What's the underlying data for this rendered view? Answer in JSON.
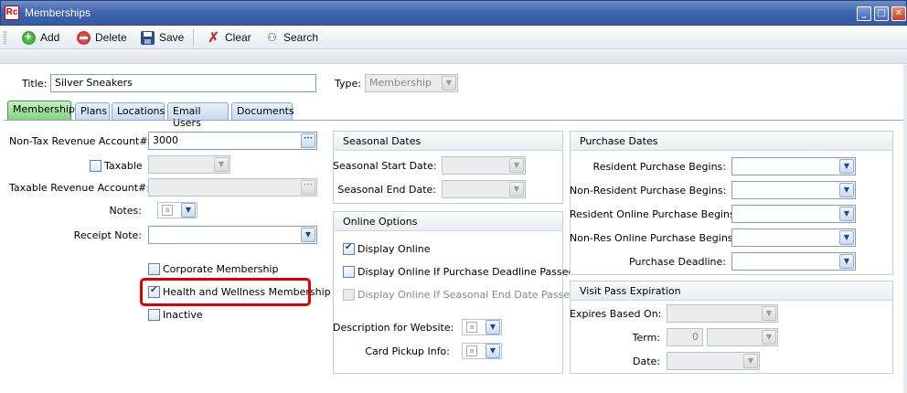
{
  "window": {
    "title": "Memberships",
    "app_icon": "Rc"
  },
  "toolbar": {
    "add": "Add",
    "delete": "Delete",
    "save": "Save",
    "clear": "Clear",
    "search": "Search"
  },
  "header": {
    "title_label": "Title:",
    "title_value": "Silver Sneakers",
    "type_label": "Type:",
    "type_value": "Membership"
  },
  "tabs": [
    "Membership",
    "Plans",
    "Locations",
    "Email Users",
    "Documents"
  ],
  "left": {
    "ntra_label": "Non-Tax Revenue Account#:",
    "ntra_value": "3000",
    "taxable_label": "Taxable",
    "tra_label": "Taxable Revenue Account#:",
    "notes_label": "Notes:",
    "receipt_label": "Receipt Note:",
    "corporate_label": "Corporate Membership",
    "health_label": "Health and Wellness Membership",
    "inactive_label": "Inactive"
  },
  "seasonal": {
    "title": "Seasonal Dates",
    "start_label": "Seasonal Start Date:",
    "end_label": "Seasonal End Date:"
  },
  "online": {
    "title": "Online Options",
    "display_online": "Display Online",
    "display_deadline": "Display Online If Purchase Deadline Passed",
    "display_seasonal": "Display Online If Seasonal End Date Passed",
    "desc_label": "Description for Website:",
    "card_label": "Card Pickup Info:"
  },
  "purchase": {
    "title": "Purchase Dates",
    "rows": [
      "Resident Purchase Begins:",
      "Non-Resident Purchase Begins:",
      "Resident Online Purchase Begins:",
      "Non-Res Online Purchase Begins:",
      "Purchase Deadline:"
    ]
  },
  "visit": {
    "title": "Visit Pass Expiration",
    "expires_label": "Expires Based On:",
    "term_label": "Term:",
    "term_value": "0",
    "date_label": "Date:"
  }
}
